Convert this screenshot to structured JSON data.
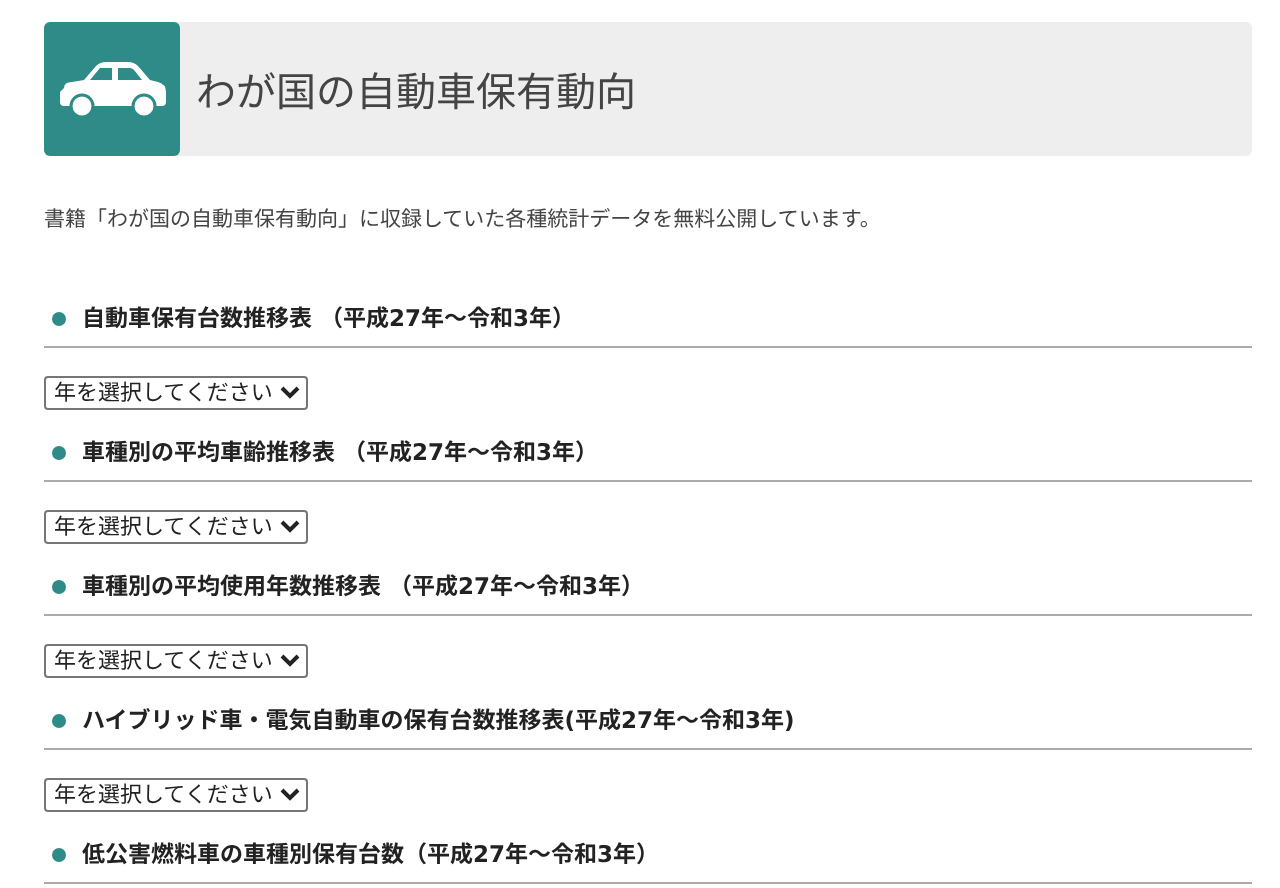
{
  "header": {
    "title": "わが国の自動車保有動向"
  },
  "description": "書籍「わが国の自動車保有動向」に収録していた各種統計データを無料公開しています。",
  "sections": [
    {
      "heading": "自動車保有台数推移表 （平成27年～令和3年）",
      "select": "年を選択してください"
    },
    {
      "heading": "車種別の平均車齢推移表 （平成27年～令和3年）",
      "select": "年を選択してください"
    },
    {
      "heading": "車種別の平均使用年数推移表 （平成27年～令和3年）",
      "select": "年を選択してください"
    },
    {
      "heading": "ハイブリッド車・電気自動車の保有台数推移表(平成27年～令和3年)",
      "select": "年を選択してください"
    },
    {
      "heading": "低公害燃料車の車種別保有台数（平成27年～令和3年）"
    }
  ]
}
